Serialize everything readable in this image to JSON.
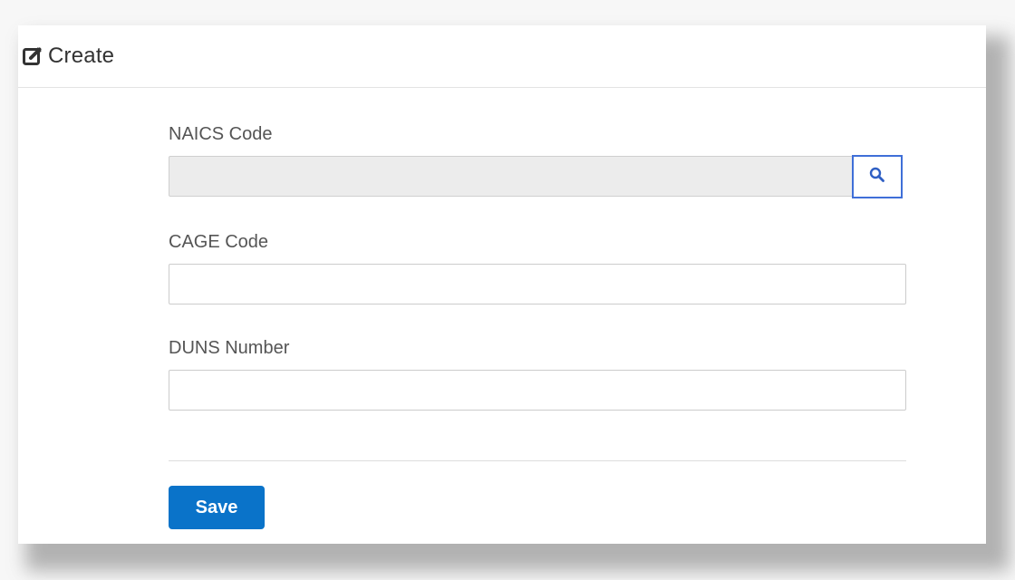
{
  "header": {
    "icon": "edit-icon",
    "title": "Create"
  },
  "form": {
    "fields": [
      {
        "label": "NAICS Code",
        "value": "",
        "readonly": true,
        "lookup_icon": "search-icon"
      },
      {
        "label": "CAGE Code",
        "value": ""
      },
      {
        "label": "DUNS Number",
        "value": ""
      }
    ],
    "save_label": "Save"
  },
  "colors": {
    "primary": "#0a73c9",
    "lookup_border": "#3f6fd8",
    "readonly_bg": "#ececec"
  }
}
